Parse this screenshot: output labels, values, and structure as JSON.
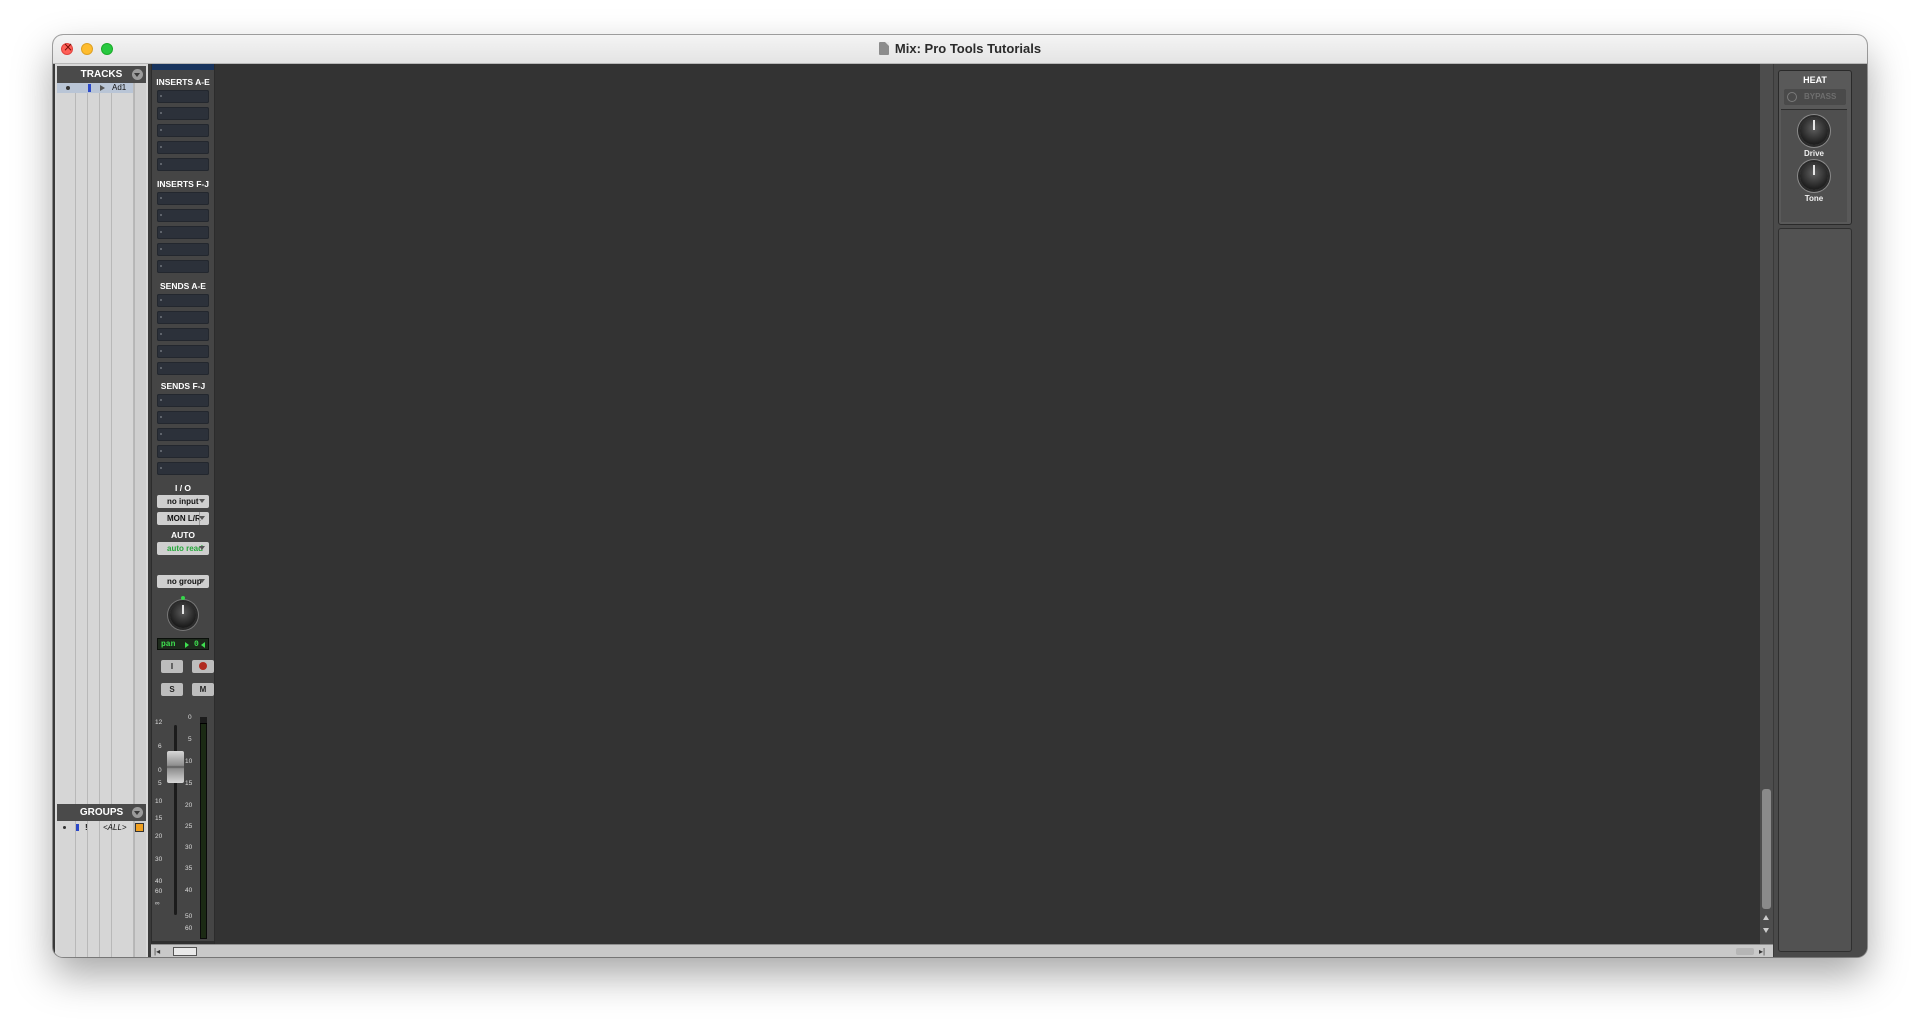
{
  "window": {
    "title": "Mix: Pro Tools Tutorials"
  },
  "tracks_panel": {
    "header": "TRACKS",
    "tracks": [
      {
        "name": "Ad1"
      }
    ]
  },
  "groups_panel": {
    "header": "GROUPS",
    "groups": [
      {
        "flag": "!",
        "name": "<ALL>"
      }
    ]
  },
  "channel_strip": {
    "inserts_ae": "INSERTS A-E",
    "inserts_fj": "INSERTS F-J",
    "sends_ae": "SENDS A-E",
    "sends_fj": "SENDS F-J",
    "io_label": "I / O",
    "input": "no input",
    "output": "MON L/R",
    "auto_label": "AUTO",
    "automation_mode": "auto read",
    "group": "no group",
    "pan_label": "pan",
    "pan_value": "0",
    "input_monitor_label": "I",
    "solo_label": "S",
    "mute_label": "M",
    "fader_scale": [
      "12",
      "6",
      "0",
      "5",
      "10",
      "15",
      "20",
      "30",
      "40",
      "60",
      "∞"
    ],
    "meter_scale": [
      "0",
      "5",
      "10",
      "15",
      "20",
      "25",
      "30",
      "35",
      "40",
      "50",
      "60"
    ]
  },
  "plugin": {
    "name": "HEAT",
    "bypass_label": "BYPASS",
    "knobs": [
      {
        "label": "Drive"
      },
      {
        "label": "Tone"
      }
    ]
  },
  "colors": {
    "automation_read": "#25a83a",
    "pan_display": "#3ee04f",
    "track_color": "#2b48c8",
    "group_color": "#f0a020"
  }
}
